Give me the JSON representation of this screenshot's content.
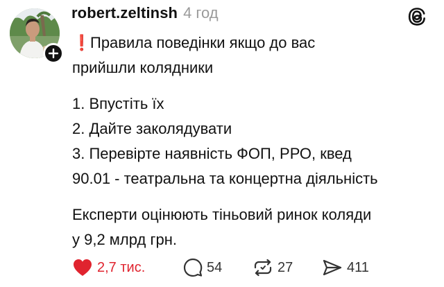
{
  "post": {
    "author": "robert.zeltinsh",
    "time_ago": "4 год",
    "lines": {
      "l1": "Правила поведінки якщо до вас",
      "l2": "прийшли колядники",
      "l3": "1. Впустіть їх",
      "l4": "2. Дайте заколядувати",
      "l5": "3. Перевірте наявність ФОП, РРО, квед",
      "l6": "90.01 - театральна та концертна діяльність",
      "l7": "Експерти оцінюють тіньовий ринок коляди",
      "l8": "у 9,2 млрд грн."
    },
    "emoji": "❗"
  },
  "actions": {
    "likes": "2,7 тис.",
    "comments": "54",
    "reposts": "27",
    "shares": "411"
  },
  "colors": {
    "accent_red": "#e0242f",
    "muted": "#9a9a9a",
    "text": "#111111"
  },
  "icons": {
    "avatar": "avatar-photo",
    "follow": "plus-icon",
    "app": "threads-logo-icon",
    "like": "heart-icon",
    "comment": "comment-bubble-icon",
    "repost": "repost-icon",
    "share": "share-send-icon"
  }
}
